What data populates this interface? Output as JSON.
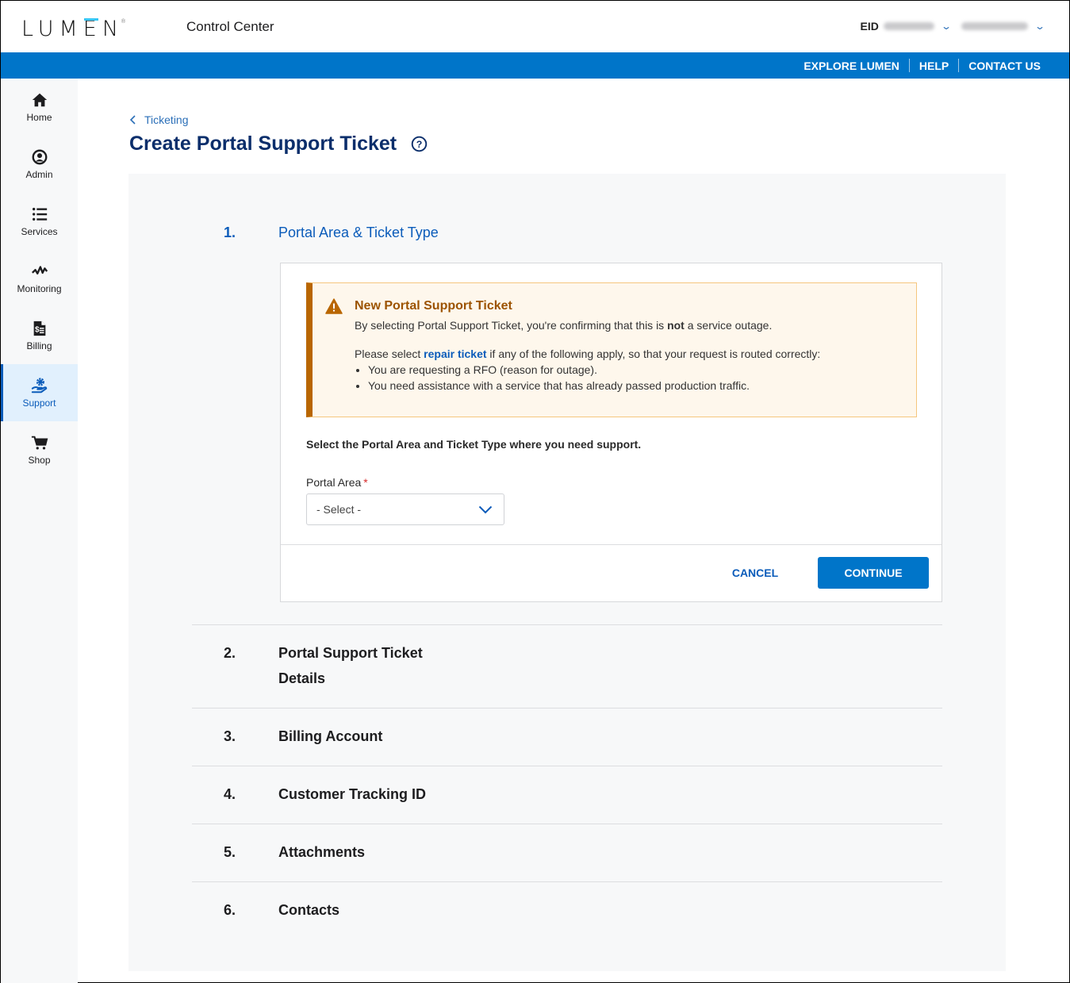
{
  "header": {
    "logo_text": "LUMEN",
    "app_title": "Control Center",
    "eid_label": "EID",
    "eid_value_redacted": true,
    "user_redacted": true
  },
  "topnav": {
    "links": [
      "EXPLORE LUMEN",
      "HELP",
      "CONTACT US"
    ]
  },
  "sidebar": {
    "items": [
      {
        "label": "Home",
        "icon": "home-icon",
        "active": false
      },
      {
        "label": "Admin",
        "icon": "user-circle-icon",
        "active": false
      },
      {
        "label": "Services",
        "icon": "list-icon",
        "active": false
      },
      {
        "label": "Monitoring",
        "icon": "pulse-icon",
        "active": false
      },
      {
        "label": "Billing",
        "icon": "invoice-icon",
        "active": false
      },
      {
        "label": "Support",
        "icon": "support-icon",
        "active": true
      },
      {
        "label": "Shop",
        "icon": "cart-icon",
        "active": false
      }
    ]
  },
  "breadcrumb": {
    "back_label": "Ticketing"
  },
  "page": {
    "title": "Create Portal Support Ticket"
  },
  "steps": [
    {
      "num": "1.",
      "label": "Portal Area & Ticket Type",
      "active": true
    },
    {
      "num": "2.",
      "label": "Portal Support Ticket Details",
      "label_line1": "Portal Support Ticket",
      "label_line2": "Details",
      "active": false
    },
    {
      "num": "3.",
      "label": "Billing Account",
      "active": false
    },
    {
      "num": "4.",
      "label": "Customer Tracking ID",
      "active": false
    },
    {
      "num": "5.",
      "label": "Attachments",
      "active": false
    },
    {
      "num": "6.",
      "label": "Contacts",
      "active": false
    }
  ],
  "alert": {
    "title": "New Portal Support Ticket",
    "line1_pre": "By selecting Portal Support Ticket, you're confirming that this is ",
    "line1_bold": "not",
    "line1_post": " a service outage.",
    "line2_pre": "Please select ",
    "line2_link": "repair ticket",
    "line2_post": " if any of the following apply, so that your request is routed correctly:",
    "bullets": [
      "You are requesting a RFO (reason for outage).",
      "You need assistance with a service that has already passed production traffic."
    ],
    "colors": {
      "accent": "#b96600",
      "background": "#fef7ec",
      "title": "#9c5300"
    }
  },
  "form": {
    "instruction": "Select the Portal Area and Ticket Type where you need support.",
    "portal_area_label": "Portal Area",
    "required_marker": "*",
    "portal_area_value": "- Select -"
  },
  "actions": {
    "cancel_label": "CANCEL",
    "continue_label": "CONTINUE"
  },
  "colors": {
    "brand_blue": "#0075c9",
    "title_navy": "#0b2e6b",
    "link_blue": "#0b5cba"
  }
}
